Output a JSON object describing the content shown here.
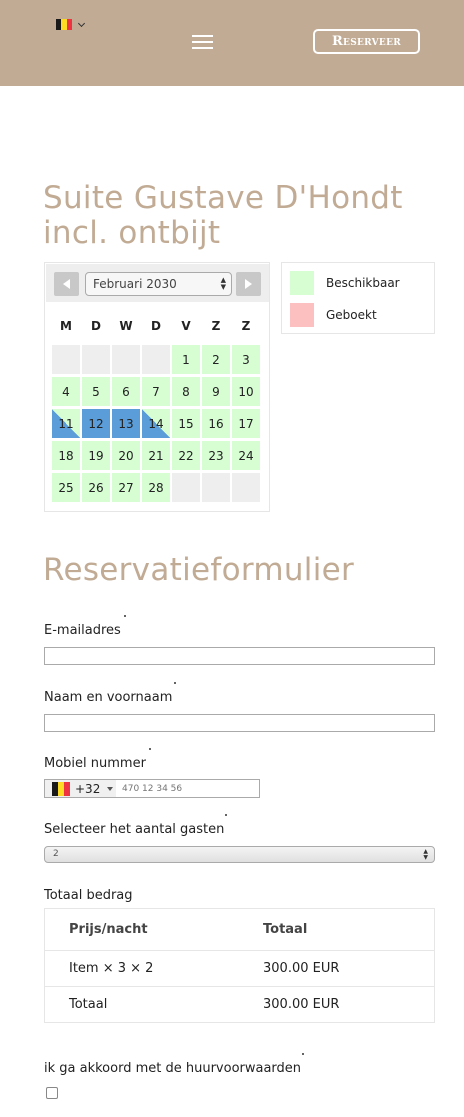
{
  "colors": {
    "header_bg": "#c1ab94",
    "accent": "#c1ab94",
    "available": "#d7fdd3",
    "booked": "#fcc0c0",
    "selected": "#5b9dd8",
    "flag_black": "#1a1a1a",
    "flag_yellow": "#fdda24",
    "flag_red": "#ef3340"
  },
  "header": {
    "language_flag": "belgium-flag-icon",
    "menu_icon": "hamburger-menu-icon",
    "reserve_label": "Reserveer"
  },
  "page": {
    "title": "Suite Gustave D'Hondt incl. ontbijt"
  },
  "calendar": {
    "month_label": "Februari 2030",
    "weekdays": [
      "M",
      "D",
      "W",
      "D",
      "V",
      "Z",
      "Z"
    ],
    "leading_empty": 4,
    "days": [
      "1",
      "2",
      "3",
      "4",
      "5",
      "6",
      "7",
      "8",
      "9",
      "10",
      "11",
      "12",
      "13",
      "14",
      "15",
      "16",
      "17",
      "18",
      "19",
      "20",
      "21",
      "22",
      "23",
      "24",
      "25",
      "26",
      "27",
      "28"
    ],
    "selected_days": [
      12,
      13
    ],
    "half_selected_days": [
      11,
      14
    ]
  },
  "legend": {
    "available_label": "Beschikbaar",
    "booked_label": "Geboekt"
  },
  "form": {
    "title": "Reservatieformulier",
    "email_label": "E-mailadres",
    "name_label": "Naam en voornaam",
    "phone_label": "Mobiel nummer",
    "phone_country_code": "+32",
    "phone_placeholder": "470 12 34 56",
    "guests_label": "Selecteer het aantal gasten",
    "guests_value": "2",
    "total_label": "Totaal bedrag",
    "agree_label": "ik ga akkoord met de huurvoorwaarden"
  },
  "totals_table": {
    "headers": [
      "Prijs/nacht",
      "Totaal"
    ],
    "rows": [
      [
        "Item × 3 × 2",
        "300.00 EUR"
      ],
      [
        "Totaal",
        "300.00 EUR"
      ]
    ]
  }
}
